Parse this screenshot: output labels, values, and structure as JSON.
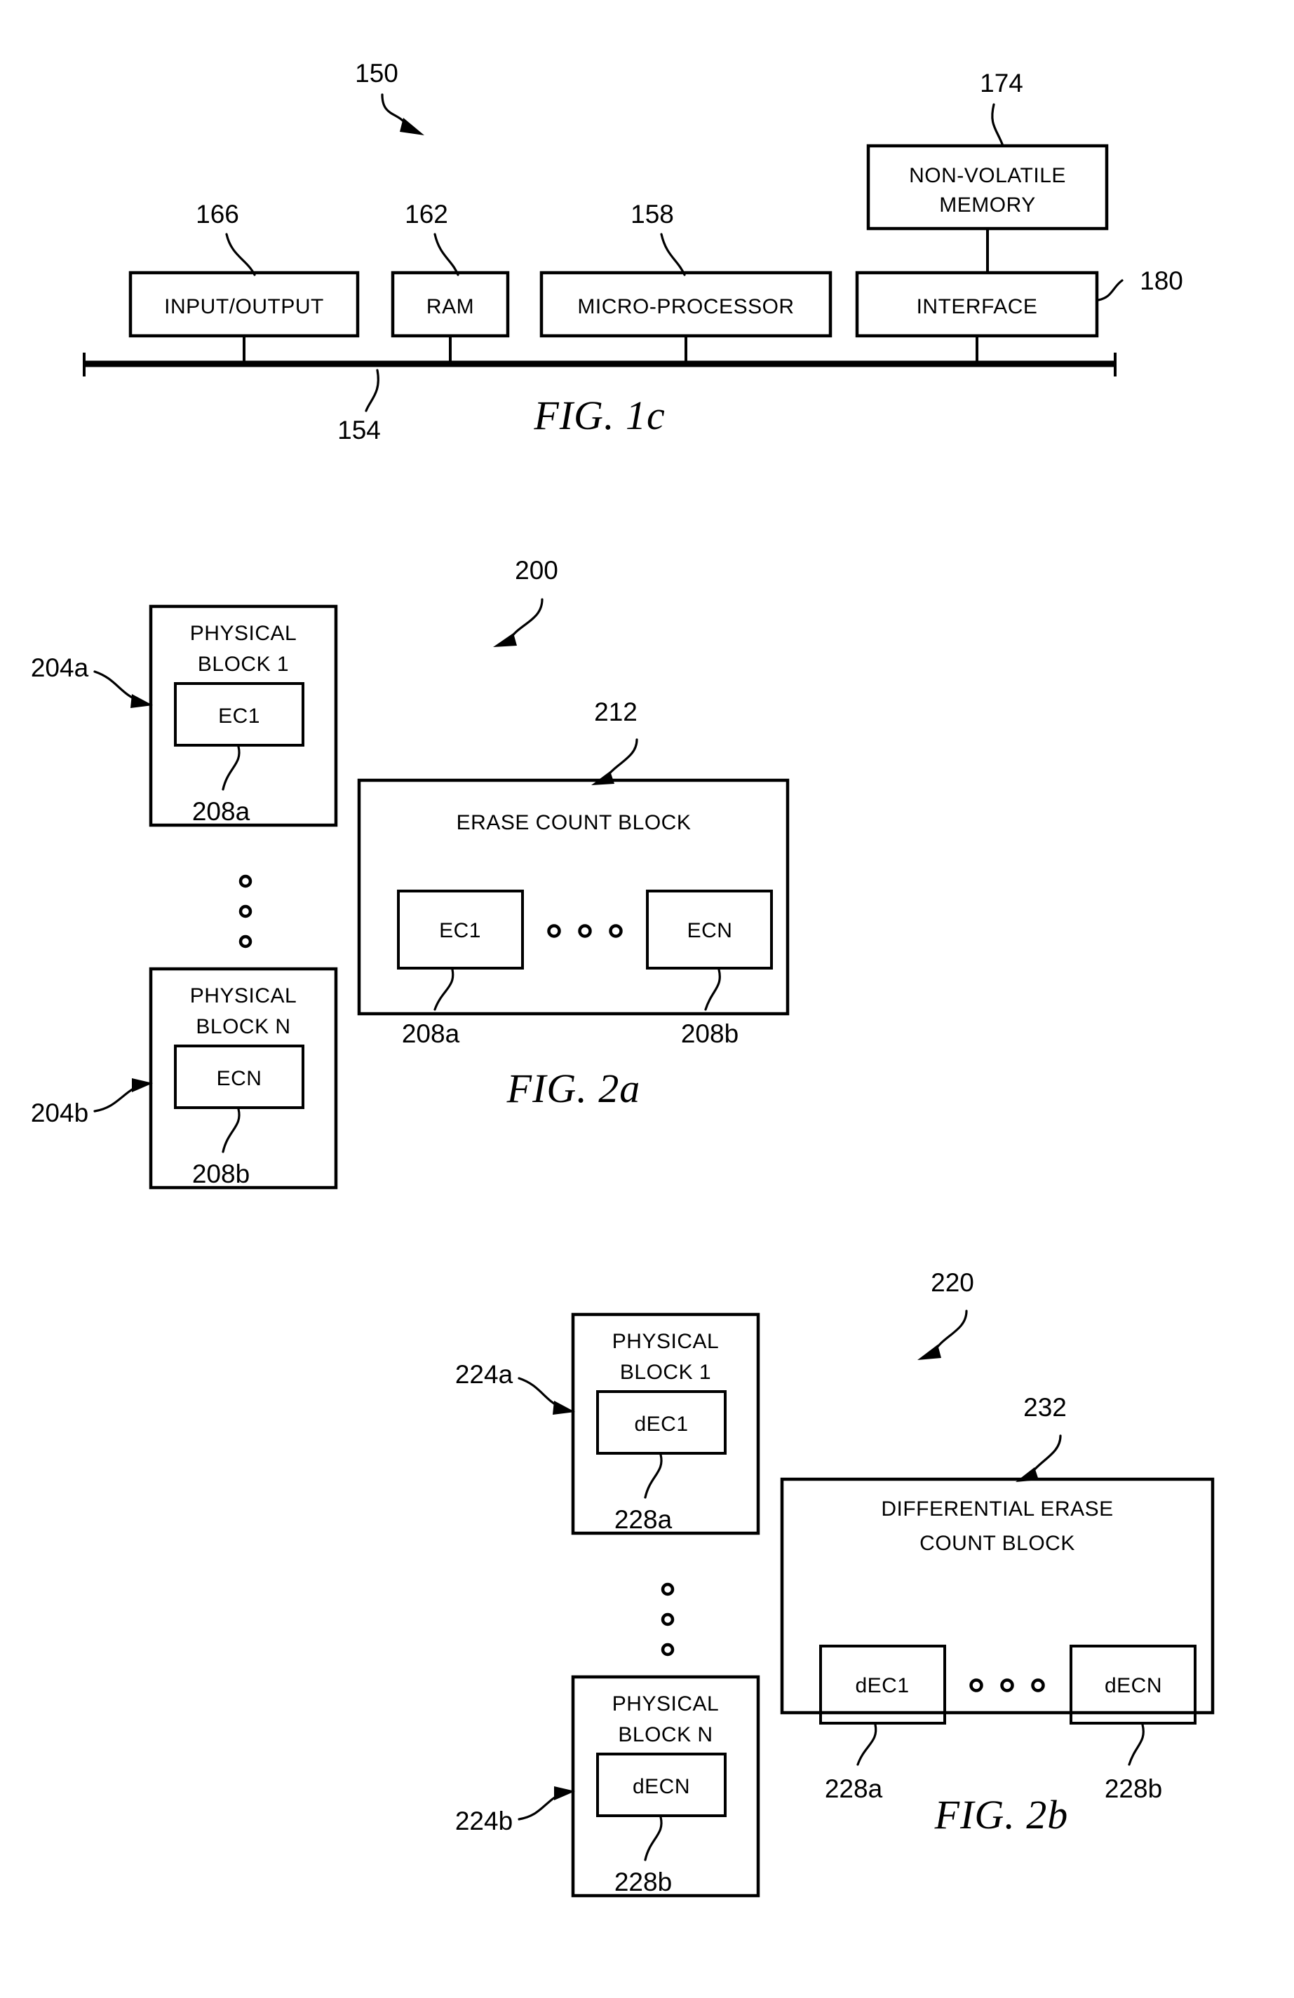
{
  "document": {
    "type": "patent-drawing-sheet",
    "page_background": "#ffffff",
    "ink_color": "#000000"
  },
  "figures": [
    {
      "id": "fig-1c",
      "caption": "FIG. 1c",
      "system_ref": "150",
      "boxes": [
        {
          "ref": "166",
          "label": "INPUT/OUTPUT"
        },
        {
          "ref": "162",
          "label": "RAM"
        },
        {
          "ref": "158",
          "label": "MICRO-PROCESSOR"
        },
        {
          "ref": "174",
          "label_line1": "NON-VOLATILE",
          "label_line2": "MEMORY"
        },
        {
          "ref": "180",
          "label": "INTERFACE"
        }
      ],
      "bus_ref": "154"
    },
    {
      "id": "fig-2a",
      "caption": "FIG. 2a",
      "system_ref": "200",
      "physical_block_first": {
        "ref": "204a",
        "title_line1": "PHYSICAL",
        "title_line2": "BLOCK 1",
        "inner_label": "EC1",
        "inner_ref": "208a"
      },
      "physical_block_last": {
        "ref": "204b",
        "title_line1": "PHYSICAL",
        "title_line2": "BLOCK N",
        "inner_label": "ECN",
        "inner_ref": "208b"
      },
      "count_block": {
        "ref": "212",
        "title": "ERASE COUNT BLOCK",
        "entry_first_label": "EC1",
        "entry_first_ref": "208a",
        "entry_last_label": "ECN",
        "entry_last_ref": "208b",
        "ellipsis_count": 3
      },
      "vertical_ellipsis_count": 3
    },
    {
      "id": "fig-2b",
      "caption": "FIG. 2b",
      "system_ref": "220",
      "physical_block_first": {
        "ref": "224a",
        "title_line1": "PHYSICAL",
        "title_line2": "BLOCK 1",
        "inner_label": "dEC1",
        "inner_ref": "228a"
      },
      "physical_block_last": {
        "ref": "224b",
        "title_line1": "PHYSICAL",
        "title_line2": "BLOCK N",
        "inner_label": "dECN",
        "inner_ref": "228b"
      },
      "count_block": {
        "ref": "232",
        "title_line1": "DIFFERENTIAL ERASE",
        "title_line2": "COUNT BLOCK",
        "entry_first_label": "dEC1",
        "entry_first_ref": "228a",
        "entry_last_label": "dECN",
        "entry_last_ref": "228b",
        "ellipsis_count": 3
      },
      "vertical_ellipsis_count": 3
    }
  ]
}
